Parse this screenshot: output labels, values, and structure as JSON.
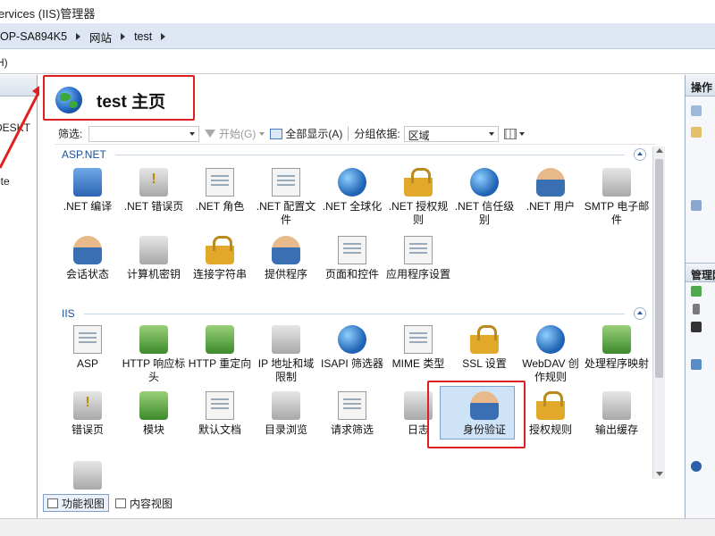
{
  "window": {
    "title": "ervices (IIS)管理器"
  },
  "address": {
    "crumbs": [
      "OP-SA894K5",
      "网站",
      "test"
    ]
  },
  "menu": {
    "partial": "H)"
  },
  "connections": {
    "items": [
      "DESKT",
      "ite"
    ]
  },
  "page": {
    "title": "test 主页"
  },
  "filter": {
    "label": "筛选:",
    "start_label": "开始(G)",
    "show_all_label": "全部显示(A)",
    "group_label": "分组依据:",
    "group_value": "区域"
  },
  "sections": [
    {
      "name": "ASP.NET",
      "items": [
        {
          "label": ".NET 编译",
          "icon": "net-compile-icon"
        },
        {
          "label": ".NET 错误页",
          "icon": "net-error-pages-icon"
        },
        {
          "label": ".NET 角色",
          "icon": "net-roles-icon"
        },
        {
          "label": ".NET 配置文件",
          "icon": "net-profile-icon"
        },
        {
          "label": ".NET 全球化",
          "icon": "net-globalization-icon"
        },
        {
          "label": ".NET 授权规则",
          "icon": "net-authorization-icon"
        },
        {
          "label": ".NET 信任级别",
          "icon": "net-trust-levels-icon"
        },
        {
          "label": ".NET 用户",
          "icon": "net-users-icon"
        },
        {
          "label": "SMTP 电子邮件",
          "icon": "smtp-email-icon"
        },
        {
          "label": "会话状态",
          "icon": "session-state-icon"
        },
        {
          "label": "计算机密钥",
          "icon": "machine-key-icon"
        },
        {
          "label": "连接字符串",
          "icon": "connection-strings-icon"
        },
        {
          "label": "提供程序",
          "icon": "providers-icon"
        },
        {
          "label": "页面和控件",
          "icon": "pages-controls-icon"
        },
        {
          "label": "应用程序设置",
          "icon": "app-settings-icon"
        }
      ]
    },
    {
      "name": "IIS",
      "items": [
        {
          "label": "ASP",
          "icon": "asp-icon"
        },
        {
          "label": "HTTP 响应标头",
          "icon": "http-response-headers-icon"
        },
        {
          "label": "HTTP 重定向",
          "icon": "http-redirect-icon"
        },
        {
          "label": "IP 地址和域限制",
          "icon": "ip-domain-restrictions-icon"
        },
        {
          "label": "ISAPI 筛选器",
          "icon": "isapi-filters-icon"
        },
        {
          "label": "MIME 类型",
          "icon": "mime-types-icon"
        },
        {
          "label": "SSL 设置",
          "icon": "ssl-settings-icon"
        },
        {
          "label": "WebDAV 创作规则",
          "icon": "webdav-icon"
        },
        {
          "label": "处理程序映射",
          "icon": "handler-mappings-icon"
        },
        {
          "label": "错误页",
          "icon": "error-pages-icon"
        },
        {
          "label": "模块",
          "icon": "modules-icon"
        },
        {
          "label": "默认文档",
          "icon": "default-document-icon"
        },
        {
          "label": "目录浏览",
          "icon": "directory-browsing-icon"
        },
        {
          "label": "请求筛选",
          "icon": "request-filtering-icon"
        },
        {
          "label": "日志",
          "icon": "logging-icon"
        },
        {
          "label": "身份验证",
          "icon": "authentication-icon"
        },
        {
          "label": "授权规则",
          "icon": "authorization-rules-icon"
        },
        {
          "label": "输出缓存",
          "icon": "output-caching-icon"
        }
      ]
    }
  ],
  "bottom_tabs": [
    {
      "label": "功能视图",
      "active": true
    },
    {
      "label": "内容视图",
      "active": false
    }
  ],
  "actions": {
    "title": "操作",
    "section2": "管理网"
  },
  "colors": {
    "accent": "#1a4f9c",
    "highlight_box": "#e02020",
    "selection": "#cfe3f8"
  }
}
